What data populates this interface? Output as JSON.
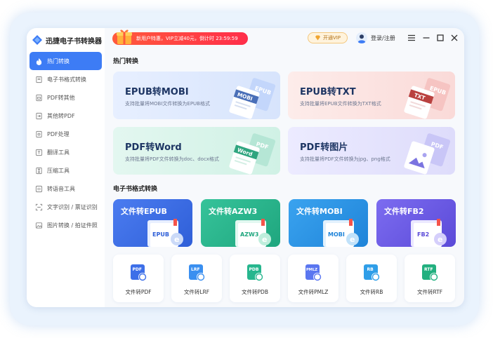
{
  "app": {
    "name": "迅捷电子书转换器"
  },
  "header": {
    "promo_text": "新用户特惠，VIP立减40元，倒计时 23:59:59",
    "vip_label": "开通VIP",
    "login_label": "登录/注册"
  },
  "sidebar": {
    "items": [
      {
        "label": "热门转换"
      },
      {
        "label": "电子书格式转换"
      },
      {
        "label": "PDF转其他"
      },
      {
        "label": "其他转PDF"
      },
      {
        "label": "PDF处理"
      },
      {
        "label": "翻译工具"
      },
      {
        "label": "压缩工具"
      },
      {
        "label": "转语音工具"
      },
      {
        "label": "文字识别 / 票证识别"
      },
      {
        "label": "图片转换 / 拍证件照"
      }
    ]
  },
  "hot": {
    "title": "热门转换",
    "cards": [
      {
        "title": "EPUB转MOBI",
        "desc": "支持批量将MOBI文件转换为EPUB格式",
        "file_tag": "MOBI",
        "back_tag": "EPUB"
      },
      {
        "title": "EPUB转TXT",
        "desc": "支持批量将EPUB文件转换为TXT格式",
        "file_tag": "TXT",
        "back_tag": "EPUB"
      },
      {
        "title": "PDF转Word",
        "desc": "支持批量将PDF文件转换为doc、docx格式",
        "file_tag": "Word",
        "back_tag": "PDF"
      },
      {
        "title": "PDF转图片",
        "desc": "支持批量将PDF文件转换为jpg、png格式",
        "file_tag": "",
        "back_tag": "PDF"
      }
    ]
  },
  "ebook": {
    "title": "电子书格式转换",
    "cards": [
      {
        "title": "文件转EPUB",
        "tag": "EPUB"
      },
      {
        "title": "文件转AZW3",
        "tag": "AZW3"
      },
      {
        "title": "文件转MOBI",
        "tag": "MOBI"
      },
      {
        "title": "文件转FB2",
        "tag": "FB2"
      }
    ]
  },
  "small": {
    "cards": [
      {
        "title": "文件转PDF",
        "tag": "PDF",
        "color": "#3d6fe8"
      },
      {
        "title": "文件转LRF",
        "tag": "LRF",
        "color": "#3a8ff0"
      },
      {
        "title": "文件转PDB",
        "tag": "PDB",
        "color": "#27b68e"
      },
      {
        "title": "文件转PMLZ",
        "tag": "PMLZ",
        "color": "#5a76f0"
      },
      {
        "title": "文件转RB",
        "tag": "RB",
        "color": "#2f9ee8"
      },
      {
        "title": "文件转RTF",
        "tag": "RTF",
        "color": "#22b07f"
      }
    ]
  },
  "colors": {
    "accent": "#3d7cf5",
    "promo": "#ff3b45",
    "vip_text": "#b3731a"
  }
}
